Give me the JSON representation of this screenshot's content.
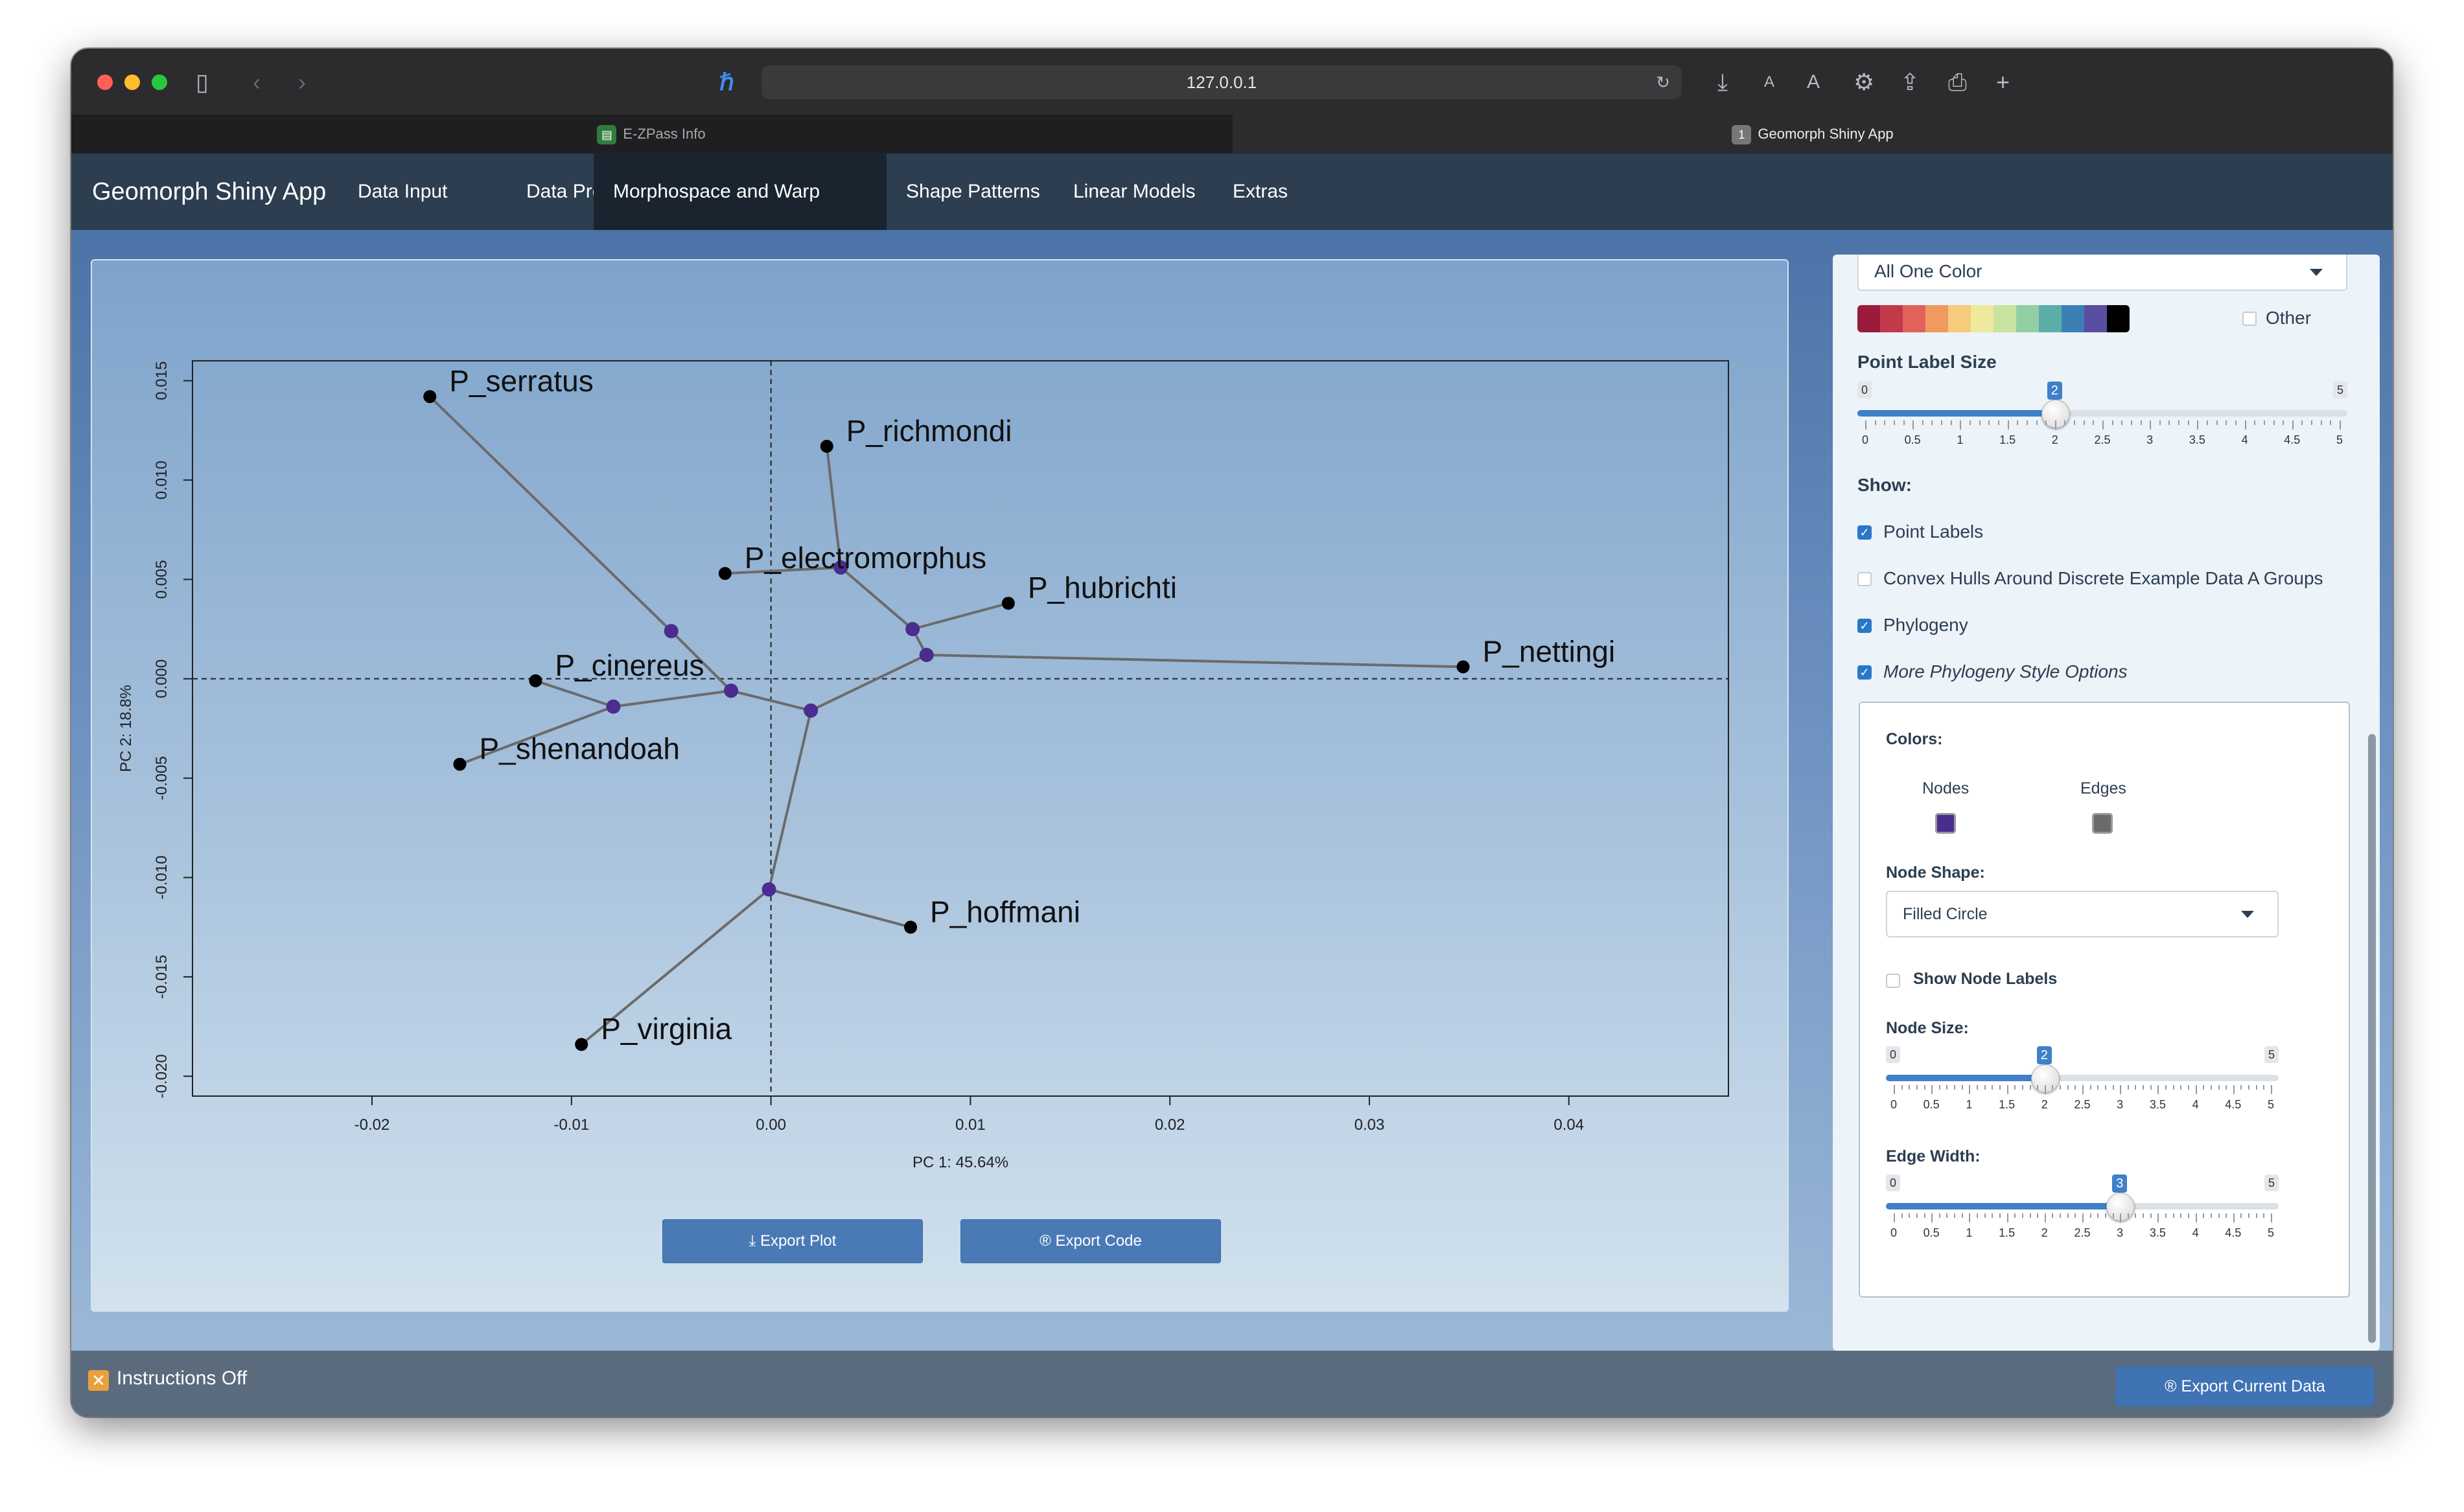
{
  "browser": {
    "url": "127.0.0.1",
    "tabs": [
      {
        "label": "E-ZPass Info",
        "active": false
      },
      {
        "label": "Geomorph Shiny App",
        "active": true,
        "badge": "1"
      }
    ]
  },
  "navbar": {
    "brand": "Geomorph Shiny App",
    "items": [
      "Data Input",
      "Data Prep",
      "Morphospace and Warp Grids",
      "Shape Patterns",
      "Linear Models",
      "Extras"
    ],
    "active_index": 2
  },
  "plot": {
    "export_plot": "Export Plot",
    "export_code": "Export Code"
  },
  "chart_data": {
    "type": "scatter",
    "xlabel": "PC 1: 45.64%",
    "ylabel": "PC 2: 18.8%",
    "xlim": [
      -0.029,
      0.048
    ],
    "ylim": [
      -0.021,
      0.016
    ],
    "xticks": [
      -0.02,
      -0.01,
      0.0,
      0.01,
      0.02,
      0.03,
      0.04
    ],
    "xtick_labels": [
      "-0.02",
      "-0.01",
      "0.00",
      "0.01",
      "0.02",
      "0.03",
      "0.04"
    ],
    "yticks": [
      -0.02,
      -0.015,
      -0.01,
      -0.005,
      0.0,
      0.005,
      0.01,
      0.015
    ],
    "ytick_labels": [
      "-0.020",
      "-0.015",
      "-0.010",
      "-0.005",
      "0.000",
      "0.005",
      "0.010",
      "0.015"
    ],
    "reference_lines": {
      "x": 0,
      "y": 0
    },
    "tips": [
      {
        "name": "P_serratus",
        "x": -0.0171,
        "y": 0.0142
      },
      {
        "name": "P_richmondi",
        "x": 0.0028,
        "y": 0.0117
      },
      {
        "name": "P_electromorphus",
        "x": -0.0023,
        "y": 0.0053
      },
      {
        "name": "P_hubrichti",
        "x": 0.0119,
        "y": 0.0038
      },
      {
        "name": "P_nettingi",
        "x": 0.0347,
        "y": 0.0006
      },
      {
        "name": "P_cinereus",
        "x": -0.0118,
        "y": -0.0001
      },
      {
        "name": "P_shenandoah",
        "x": -0.0156,
        "y": -0.0043
      },
      {
        "name": "P_hoffmani",
        "x": 0.007,
        "y": -0.0125
      },
      {
        "name": "P_virginia",
        "x": -0.0095,
        "y": -0.0184
      }
    ],
    "nodes": [
      {
        "id": "n1",
        "x": -0.005,
        "y": 0.0024
      },
      {
        "id": "n2",
        "x": 0.0035,
        "y": 0.0056
      },
      {
        "id": "n3",
        "x": 0.0071,
        "y": 0.0025
      },
      {
        "id": "n4",
        "x": 0.0078,
        "y": 0.0012
      },
      {
        "id": "n5",
        "x": -0.002,
        "y": -0.0006
      },
      {
        "id": "n6",
        "x": -0.0079,
        "y": -0.0014
      },
      {
        "id": "n7",
        "x": 0.002,
        "y": -0.0016
      },
      {
        "id": "n8",
        "x": -0.0001,
        "y": -0.0106
      }
    ],
    "edges": [
      [
        "P_serratus",
        "n1"
      ],
      [
        "n1",
        "n5"
      ],
      [
        "P_richmondi",
        "n2"
      ],
      [
        "P_electromorphus",
        "n2"
      ],
      [
        "n2",
        "n3"
      ],
      [
        "P_hubrichti",
        "n3"
      ],
      [
        "n3",
        "n4"
      ],
      [
        "P_nettingi",
        "n4"
      ],
      [
        "n4",
        "n7"
      ],
      [
        "P_cinereus",
        "n6"
      ],
      [
        "P_shenandoah",
        "n6"
      ],
      [
        "n6",
        "n5"
      ],
      [
        "n5",
        "n7"
      ],
      [
        "n7",
        "n8"
      ],
      [
        "P_hoffmani",
        "n8"
      ],
      [
        "P_virginia",
        "n8"
      ]
    ],
    "colors": {
      "node": "#4b2c8f",
      "edge": "#6b6b6b",
      "tip": "#000000"
    }
  },
  "sidebar": {
    "color_select": "All One Color",
    "palette": [
      "#9b1c3a",
      "#c2394a",
      "#e0625a",
      "#f19a5f",
      "#f6cb7c",
      "#eee99c",
      "#c8e29f",
      "#93cfa4",
      "#5aaea7",
      "#3c7fb5",
      "#5a4ea2",
      "#000000"
    ],
    "other_label": "Other",
    "point_label_size": {
      "title": "Point Label Size",
      "min": "0",
      "max": "5",
      "value": 2,
      "value_label": "2",
      "ticks": [
        "0",
        "0.5",
        "1",
        "1.5",
        "2",
        "2.5",
        "3",
        "3.5",
        "4",
        "4.5",
        "5"
      ]
    },
    "show_title": "Show:",
    "show_options": [
      {
        "label": "Point Labels",
        "checked": true,
        "italic": false
      },
      {
        "label": "Convex Hulls Around Discrete Example Data A Groups",
        "checked": false,
        "italic": false
      },
      {
        "label": "Phylogeny",
        "checked": true,
        "italic": false
      },
      {
        "label": "More Phylogeny Style Options",
        "checked": true,
        "italic": true
      }
    ],
    "phylo": {
      "colors_title": "Colors:",
      "nodes_label": "Nodes",
      "edges_label": "Edges",
      "nodes_color": "#4b2c8f",
      "edges_color": "#6b6b6b",
      "node_shape_title": "Node Shape:",
      "node_shape_value": "Filled Circle",
      "show_node_labels": "Show Node Labels",
      "node_size": {
        "title": "Node Size:",
        "min": "0",
        "max": "5",
        "value": 2,
        "value_label": "2"
      },
      "edge_width": {
        "title": "Edge Width:",
        "min": "0",
        "max": "5",
        "value": 3,
        "value_label": "3"
      }
    }
  },
  "footer": {
    "instructions": "Instructions Off",
    "export_data": "Export Current Data"
  }
}
